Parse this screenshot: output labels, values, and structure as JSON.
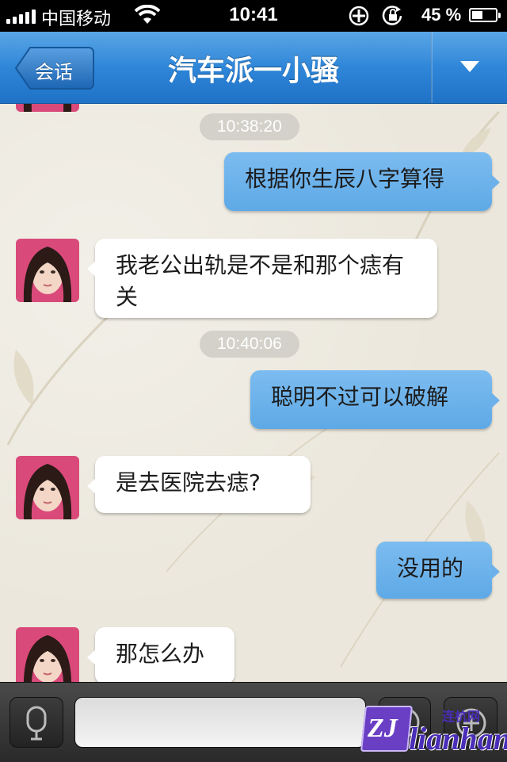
{
  "status_bar": {
    "carrier": "中国移动",
    "time": "10:41",
    "battery_percent": "45 %",
    "battery_level": 0.45,
    "icons": [
      "signal-icon",
      "wifi-icon",
      "orientation-lock-icon",
      "location-icon",
      "battery-icon"
    ]
  },
  "nav": {
    "back_label": "会话",
    "title": "汽车派一小骚",
    "menu_icon": "dropdown-triangle-icon"
  },
  "messages": [
    {
      "type": "timestamp",
      "text": "10:38:20"
    },
    {
      "type": "out",
      "text": "根据你生辰八字算得"
    },
    {
      "type": "in",
      "text": "我老公出轨是不是和那个痣有关"
    },
    {
      "type": "timestamp",
      "text": "10:40:06"
    },
    {
      "type": "out",
      "text": "聪明不过可以破解"
    },
    {
      "type": "in",
      "text": "是去医院去痣?"
    },
    {
      "type": "out",
      "text": "没用的"
    },
    {
      "type": "in",
      "text": "那怎么办"
    }
  ],
  "input_bar": {
    "voice_icon": "microphone-icon",
    "input_value": "",
    "emoji_icon": "emoji-icon",
    "plus_icon": "plus-icon"
  },
  "watermark": {
    "logo": "ZJ",
    "word": "lianhang",
    "small": "连杭网"
  },
  "colors": {
    "nav_blue": "#2f86d8",
    "bubble_out": "#6db1eb",
    "bubble_in": "#ffffff",
    "chat_bg": "#ebe7dc"
  }
}
